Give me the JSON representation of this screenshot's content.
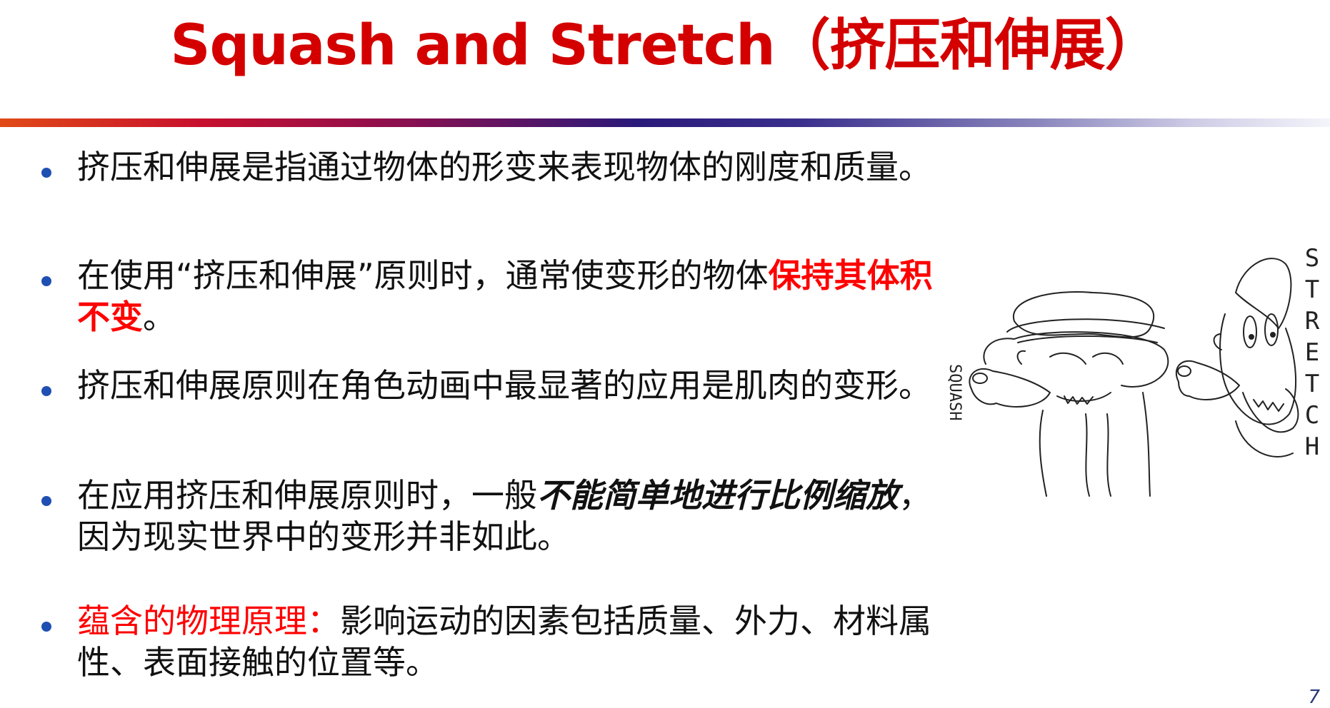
{
  "slide": {
    "title": "Squash and Stretch（挤压和伸展）",
    "bullets": [
      {
        "text": "挤压和伸展是指通过物体的形变来表现物体的刚度和质量。"
      },
      {
        "pre": "在使用“挤压和伸展”原则时，通常使变形的物体",
        "emphasis": "保持其体积不变",
        "post": "。"
      },
      {
        "text": "挤压和伸展原则在角色动画中最显著的应用是肌肉的变形。"
      },
      {
        "pre": "在应用挤压和伸展原则时，一般",
        "emphasis": "不能简单地进行比例缩放",
        "post": "，因为现实世界中的变形并非如此。"
      },
      {
        "label": "蕴含的物理原理：",
        "post": "影响运动的因素包括质量、外力、材料属性、表面接触的位置等。"
      }
    ],
    "illustration": {
      "squash_label": "SQUASH",
      "stretch_label": "STRETCH"
    },
    "page_number": "7"
  },
  "colors": {
    "title": "#d40000",
    "emphasis": "#ff0000",
    "bullet_dot": "#1f4fb3",
    "text": "#111111"
  }
}
